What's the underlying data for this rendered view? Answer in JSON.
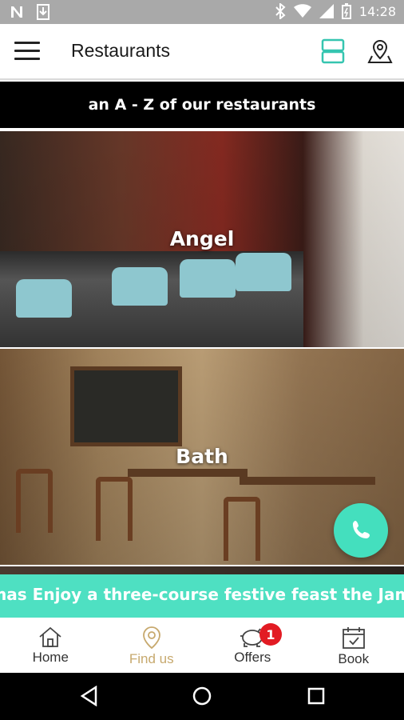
{
  "status_bar": {
    "time": "14:28",
    "icons": [
      "n-icon",
      "download-icon",
      "bluetooth-icon",
      "wifi-icon",
      "signal-icon",
      "battery-icon"
    ]
  },
  "app_bar": {
    "title": "Restaurants",
    "icons": [
      "menu-icon",
      "list-view-icon",
      "map-pin-icon"
    ],
    "accent": "#35c5b0"
  },
  "banner": {
    "text": "an A - Z of our restaurants"
  },
  "restaurants": [
    {
      "name": "Angel"
    },
    {
      "name": "Bath"
    }
  ],
  "ticker": {
    "text": "stmas   Enjoy a three-course festive feast the Jam",
    "color": "#4ee0c2"
  },
  "bottom_nav": {
    "items": [
      {
        "label": "Home",
        "icon": "home-icon",
        "active": false
      },
      {
        "label": "Find us",
        "icon": "location-pin-icon",
        "active": true
      },
      {
        "label": "Offers",
        "icon": "piggy-bank-icon",
        "active": false,
        "badge": "1"
      },
      {
        "label": "Book",
        "icon": "calendar-check-icon",
        "active": false
      }
    ],
    "active_color": "#c7a96e",
    "badge_color": "#e21b23"
  },
  "call_button": {
    "icon": "phone-icon",
    "color": "#44dfbe"
  }
}
